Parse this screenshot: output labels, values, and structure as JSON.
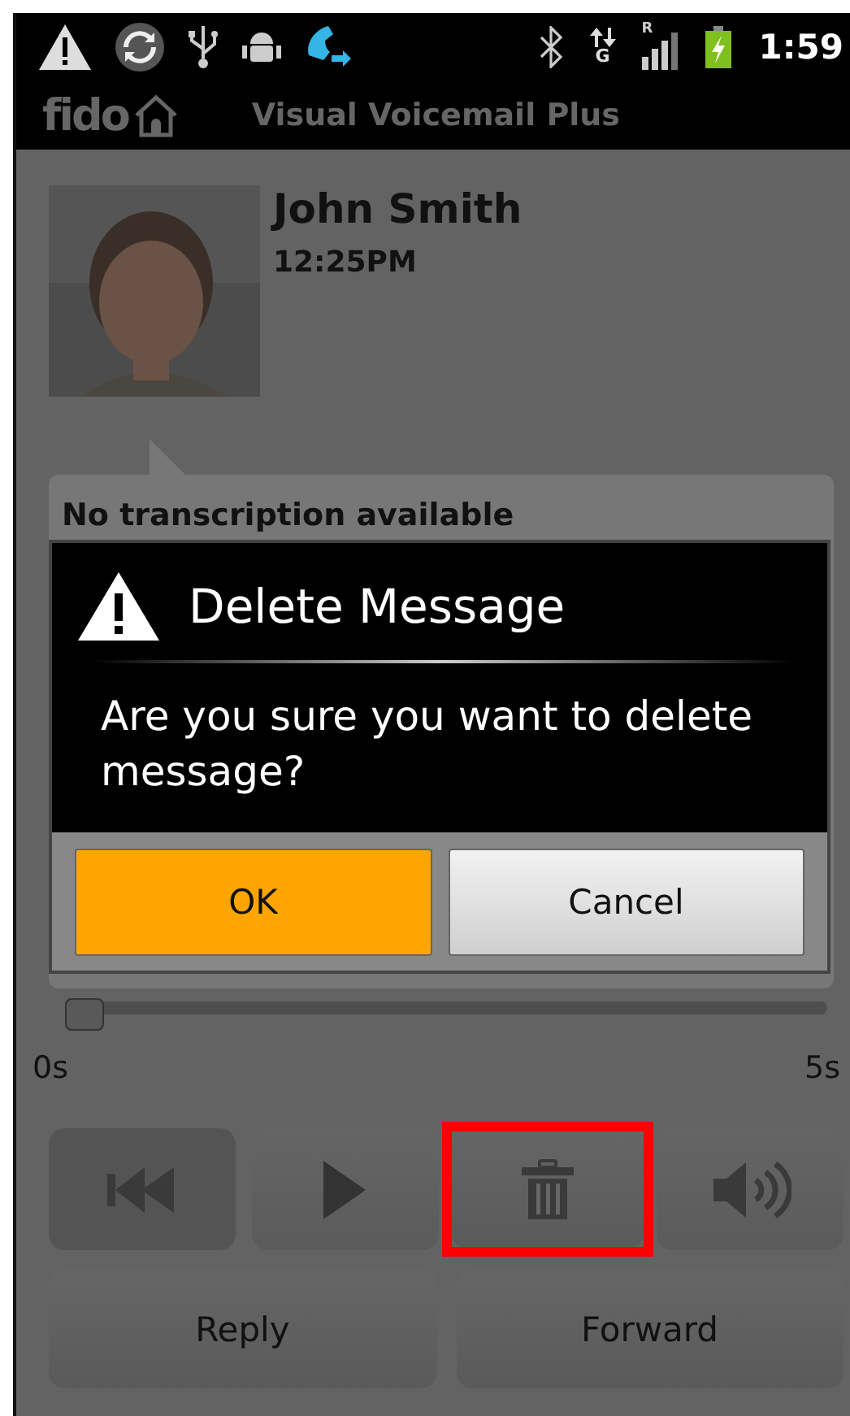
{
  "status_bar": {
    "data_type": "G",
    "roaming": "R",
    "time": "1:59"
  },
  "app_bar": {
    "logo": "fido",
    "title": "Visual Voicemail Plus"
  },
  "message": {
    "caller": "John Smith",
    "time": "12:25PM",
    "transcription": "No transcription available"
  },
  "playback": {
    "level": 0,
    "start": "0s",
    "end": "5s"
  },
  "controls": [
    {
      "kind": "rewind",
      "highlighted": false
    },
    {
      "kind": "play",
      "highlighted": false
    },
    {
      "kind": "delete",
      "highlighted": true
    },
    {
      "kind": "speaker",
      "highlighted": false
    }
  ],
  "actions": [
    "Reply",
    "Forward"
  ],
  "dialog": {
    "title": "Delete Message",
    "text": "Are you sure you want to delete message?",
    "buttons": [
      {
        "label": "OK",
        "selected": true
      },
      {
        "label": "Cancel",
        "selected": false
      }
    ]
  }
}
